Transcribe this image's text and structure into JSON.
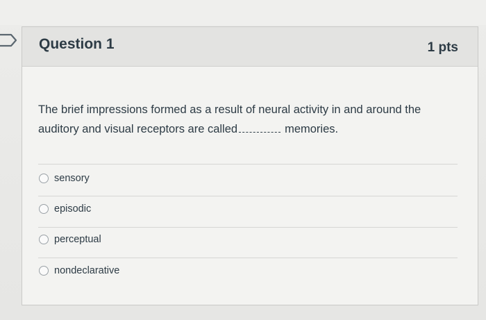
{
  "question": {
    "title": "Question 1",
    "points": "1 pts",
    "text_before": "The brief impressions formed as a result of neural activity in and around the auditory and visual receptors are called",
    "text_after": "memories."
  },
  "answers": [
    {
      "label": "sensory",
      "selected": false
    },
    {
      "label": "episodic",
      "selected": false
    },
    {
      "label": "perceptual",
      "selected": false
    },
    {
      "label": "nondeclarative",
      "selected": false
    }
  ],
  "icons": {
    "flag": "flag-outline-icon",
    "radio": "radio-button-icon"
  },
  "colors": {
    "text": "#2d3b45",
    "header_bg": "#e3e3e1",
    "card_bg": "#f3f3f1"
  }
}
